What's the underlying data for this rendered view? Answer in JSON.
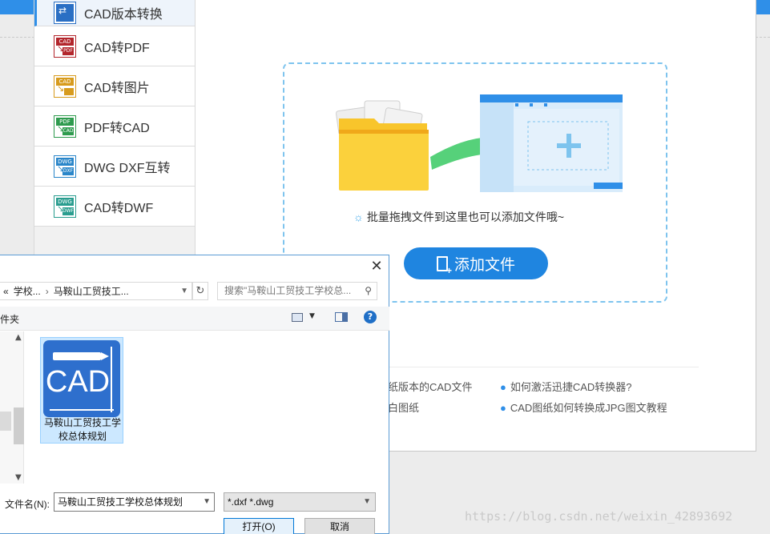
{
  "sidebar": {
    "items": [
      {
        "label": "CAD版本转换",
        "icon": "cad-version-convert-icon",
        "top": "",
        "bottom": "",
        "color": "#2a6fc4"
      },
      {
        "label": "CAD转PDF",
        "icon": "cad-to-pdf-icon",
        "top": "CAD",
        "bottom": "PDF",
        "color": "#b3262c"
      },
      {
        "label": "CAD转图片",
        "icon": "cad-to-image-icon",
        "top": "CAD",
        "bottom": "",
        "color": "#d79b1d"
      },
      {
        "label": "PDF转CAD",
        "icon": "pdf-to-cad-icon",
        "top": "PDF",
        "bottom": "CAD",
        "color": "#2e9b4e"
      },
      {
        "label": "DWG DXF互转",
        "icon": "dwg-dxf-convert-icon",
        "top": "DWG",
        "bottom": "DXF",
        "color": "#2a86c9"
      },
      {
        "label": "CAD转DWF",
        "icon": "cad-to-dwf-icon",
        "top": "DWG",
        "bottom": "DWF",
        "color": "#2a9d8f"
      }
    ]
  },
  "main": {
    "hint": "批量拖拽文件到这里也可以添加文件哦~",
    "add_button": "添加文件",
    "faq_left": [
      "纸版本的CAD文件",
      "白图纸"
    ],
    "faq_right": [
      "如何激活迅捷CAD转换器?",
      "CAD图纸如何转换成JPG图文教程"
    ]
  },
  "dialog": {
    "breadcrumb": [
      "«",
      "学校...",
      "›",
      "马鞍山工贸技工..."
    ],
    "search_placeholder": "搜索\"马鞍山工贸技工学校总...",
    "new_folder": "件夹",
    "file": {
      "name": "马鞍山工贸技工学校总体规划",
      "icon_text": "CAD"
    },
    "filename_label": "文件名(N):",
    "filename_value": "马鞍山工贸技工学校总体规划",
    "filetype": "*.dxf *.dwg",
    "open_button": "打开(O)",
    "cancel_button": "取消",
    "close_glyph": "✕",
    "help_glyph": "?"
  },
  "watermark": "https://blog.csdn.net/weixin_42893692",
  "colors": {
    "accent": "#1f85e0",
    "dash": "#7ec4ee",
    "selection": "#cce8ff",
    "brand_blue": "#2f8fe8"
  }
}
